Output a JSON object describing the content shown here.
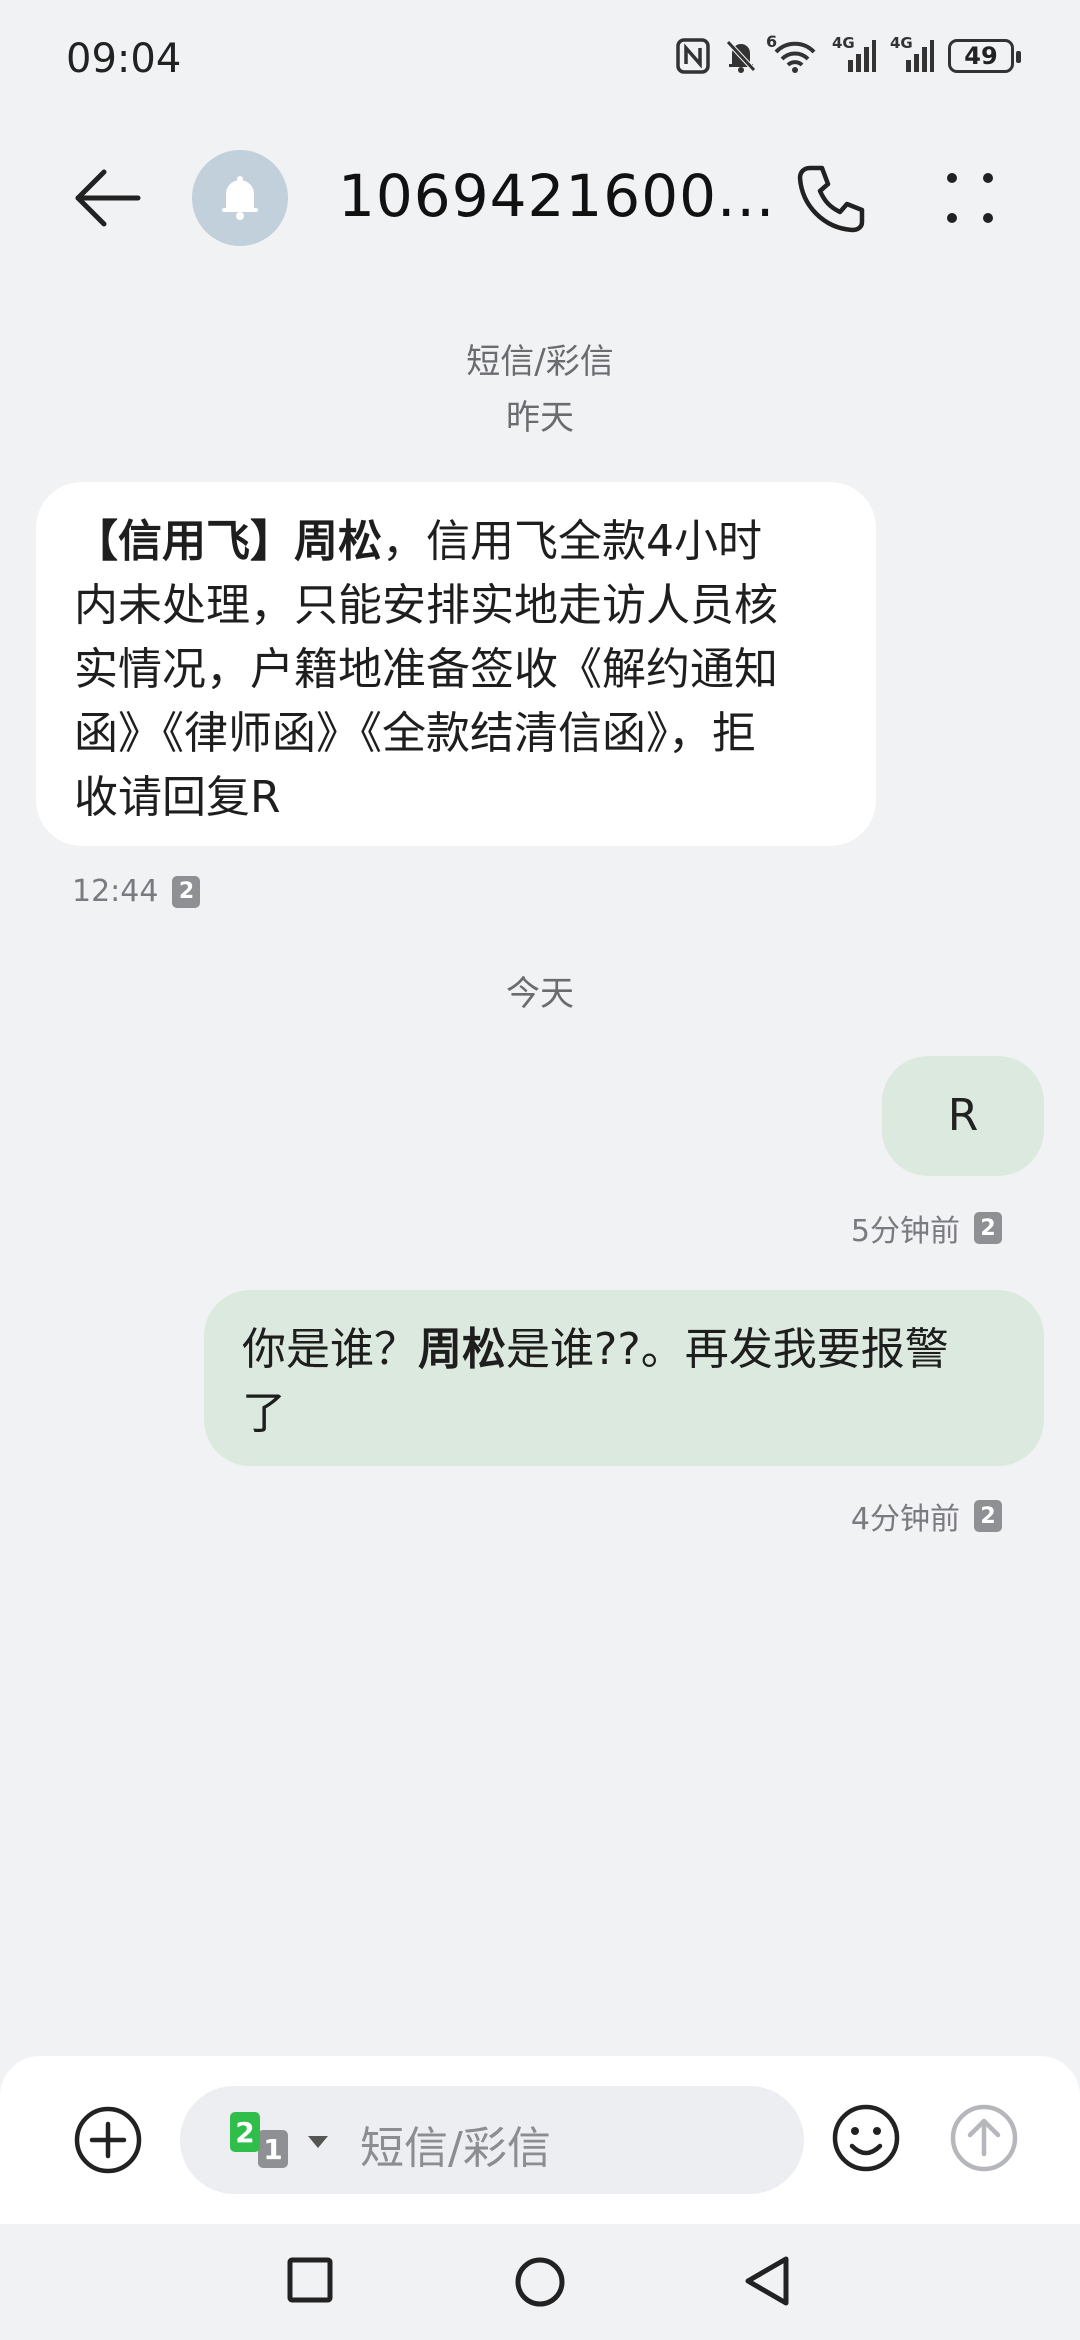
{
  "status_bar": {
    "time": "09:04",
    "icons": [
      "nfc-icon",
      "bell-off-icon",
      "wifi-6-icon",
      "signal-4g-icon",
      "signal-4g-icon"
    ],
    "wifi_label": "6",
    "sim1_label": "4G",
    "sim2_label": "4G",
    "battery": "49"
  },
  "header": {
    "contact": "1069421600...",
    "back_icon": "back-arrow-icon",
    "avatar_icon": "bell-icon",
    "call_icon": "phone-icon",
    "more_icon": "more-vertical-icon"
  },
  "conversation": {
    "type_label": "短信/彩信",
    "day_1": "昨天",
    "day_2": "今天",
    "incoming": {
      "pre": "【信用飞】",
      "name": "周松",
      "line1_rest": "，信用飞全款4小时",
      "line2": "内未处理，只能安排实地走访人员核",
      "line3": "实情况，户籍地准备签收《解约通知",
      "line4": "函》《律师函》《全款结清信函》，拒",
      "line5": "收请回复R",
      "time": "12:44",
      "sim": "2"
    },
    "outgoing": [
      {
        "text": "R",
        "time": "5分钟前",
        "sim": "2"
      },
      {
        "pre": "你是谁？",
        "name": "周松",
        "post": "是谁??。再发我要报警",
        "line2": "了",
        "time": "4分钟前",
        "sim": "2"
      }
    ]
  },
  "composer": {
    "placeholder": "短信/彩信",
    "sim_primary": "2",
    "sim_secondary": "1",
    "add_icon": "add-circle-icon",
    "emoji_icon": "emoji-icon",
    "send_icon": "send-icon",
    "sim_accent": "#2fbe4a"
  },
  "nav": {
    "recents_icon": "recents-square-icon",
    "home_icon": "home-circle-icon",
    "back_icon": "back-triangle-icon"
  }
}
